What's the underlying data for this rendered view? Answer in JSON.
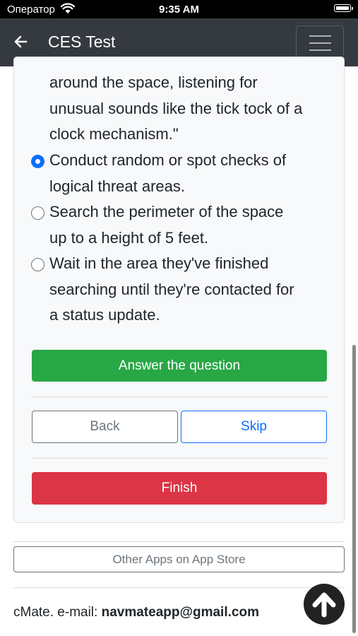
{
  "status_bar": {
    "carrier": "Оператор",
    "time": "9:35 AM"
  },
  "navbar": {
    "title": "CES Test"
  },
  "question": {
    "lines": [
      "around the space, listening for",
      "unusual sounds like the tick tock of a",
      "clock mechanism.\""
    ]
  },
  "options": [
    {
      "lines": [
        "Conduct random or spot checks of",
        "logical threat areas."
      ],
      "selected": true
    },
    {
      "lines": [
        "Search the perimeter of the space",
        "up to a height of 5 feet."
      ],
      "selected": false
    },
    {
      "lines": [
        "Wait in the area they've finished",
        "searching until they're contacted for",
        "a status update."
      ],
      "selected": false
    }
  ],
  "buttons": {
    "answer": "Answer the question",
    "back": "Back",
    "skip": "Skip",
    "finish": "Finish",
    "other_apps": "Other Apps on App Store"
  },
  "footer": {
    "prefix": "cMate. e-mail: ",
    "email": "navmateapp@gmail.com"
  },
  "colors": {
    "navbar": "#343a40",
    "success": "#28a745",
    "primary": "#0d6efd",
    "danger": "#dc3545",
    "secondary": "#6c757d"
  },
  "icons": [
    "wifi-icon",
    "battery-icon",
    "back-arrow-icon",
    "hamburger-menu-icon",
    "radio-checked-icon",
    "radio-unchecked-icon",
    "arrow-up-circle-icon"
  ]
}
